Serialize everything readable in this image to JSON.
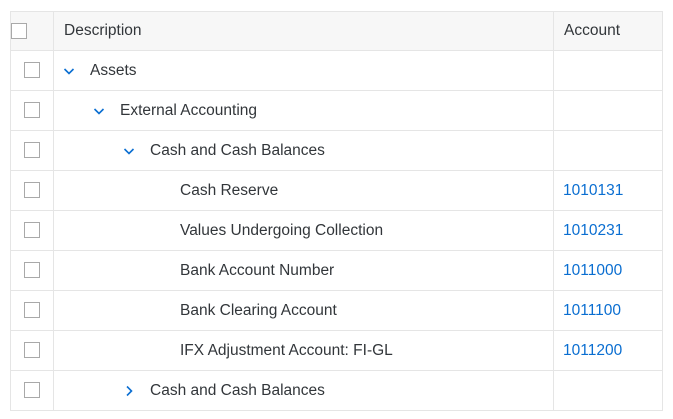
{
  "table": {
    "columns": {
      "description": "Description",
      "account": "Account"
    },
    "rows": [
      {
        "level": 0,
        "toggle": "expanded",
        "description": "Assets",
        "account": ""
      },
      {
        "level": 1,
        "toggle": "expanded",
        "description": "External Accounting",
        "account": ""
      },
      {
        "level": 2,
        "toggle": "expanded",
        "description": "Cash and Cash Balances",
        "account": ""
      },
      {
        "level": 3,
        "toggle": "none",
        "description": "Cash Reserve",
        "account": "1010131"
      },
      {
        "level": 3,
        "toggle": "none",
        "description": "Values Undergoing Collection",
        "account": "1010231"
      },
      {
        "level": 3,
        "toggle": "none",
        "description": "Bank Account Number",
        "account": "1011000"
      },
      {
        "level": 3,
        "toggle": "none",
        "description": "Bank Clearing Account",
        "account": "1011100"
      },
      {
        "level": 3,
        "toggle": "none",
        "description": "IFX Adjustment Account: FI-GL",
        "account": "1011200"
      },
      {
        "level": 2,
        "toggle": "collapsed",
        "description": "Cash and Cash Balances",
        "account": ""
      }
    ]
  },
  "icons": {
    "expanded": "chevron-down-icon",
    "collapsed": "chevron-right-icon",
    "checkbox": "checkbox-unchecked"
  },
  "colors": {
    "link": "#0a6ed1",
    "chevron": "#0a6ed1",
    "header_bg": "#f7f7f7",
    "border": "#e5e5e5",
    "text": "#32363a"
  }
}
